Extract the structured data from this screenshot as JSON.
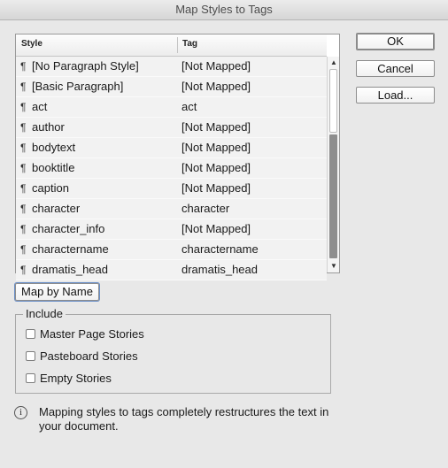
{
  "window": {
    "title": "Map Styles to Tags"
  },
  "table": {
    "headers": {
      "style": "Style",
      "tag": "Tag"
    },
    "pilcrow": "¶",
    "rows": [
      {
        "style": "[No Paragraph Style]",
        "tag": "[Not Mapped]"
      },
      {
        "style": "[Basic Paragraph]",
        "tag": "[Not Mapped]"
      },
      {
        "style": "act",
        "tag": "act"
      },
      {
        "style": "author",
        "tag": "[Not Mapped]"
      },
      {
        "style": "bodytext",
        "tag": "[Not Mapped]"
      },
      {
        "style": "booktitle",
        "tag": "[Not Mapped]"
      },
      {
        "style": "caption",
        "tag": "[Not Mapped]"
      },
      {
        "style": "character",
        "tag": "character"
      },
      {
        "style": "character_info",
        "tag": "[Not Mapped]"
      },
      {
        "style": "charactername",
        "tag": "charactername"
      },
      {
        "style": "dramatis_head",
        "tag": "dramatis_head"
      }
    ]
  },
  "buttons": {
    "ok": "OK",
    "cancel": "Cancel",
    "load": "Load...",
    "map_by_name": "Map by Name"
  },
  "include": {
    "label": "Include",
    "options": [
      {
        "label": "Master Page Stories",
        "checked": false
      },
      {
        "label": "Pasteboard Stories",
        "checked": false
      },
      {
        "label": "Empty Stories",
        "checked": false
      }
    ]
  },
  "info": {
    "icon": "info-icon",
    "text": "Mapping styles to tags completely restructures the text in your document."
  }
}
